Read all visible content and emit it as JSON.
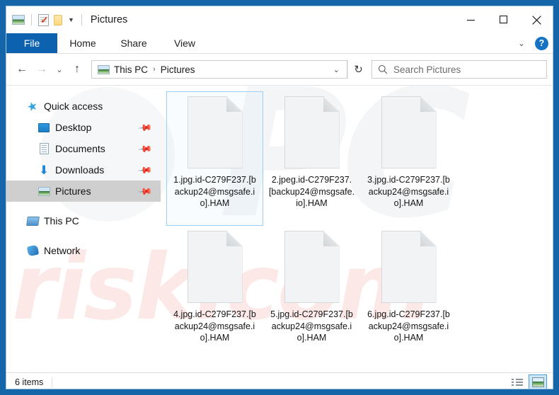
{
  "window": {
    "title": "Pictures",
    "quick_access_toolbar": [
      {
        "name": "pictures-icon",
        "label": "Pictures"
      },
      {
        "name": "properties-icon",
        "label": "Properties"
      },
      {
        "name": "new-folder-icon",
        "label": "New folder"
      },
      {
        "name": "customize-caret-icon",
        "label": "▾"
      }
    ],
    "controls": {
      "minimize": "Minimize",
      "maximize": "Maximize",
      "close": "Close"
    }
  },
  "ribbon": {
    "tabs": [
      {
        "label": "File",
        "active": true
      },
      {
        "label": "Home",
        "active": false
      },
      {
        "label": "Share",
        "active": false
      },
      {
        "label": "View",
        "active": false
      }
    ],
    "expand_caret": "⌄",
    "help_label": "?"
  },
  "navigation": {
    "back": "←",
    "forward": "→",
    "recent": "⌄",
    "up": "↑",
    "refresh": "↻",
    "address_caret": "⌄",
    "breadcrumb": [
      "This PC",
      "Pictures"
    ],
    "breadcrumb_separator": "›"
  },
  "search": {
    "placeholder": "Search Pictures",
    "value": "",
    "icon": "search-icon"
  },
  "sidebar": {
    "items": [
      {
        "label": "Quick access",
        "icon": "star-icon",
        "level": 0,
        "pinned": false,
        "selected": false
      },
      {
        "label": "Desktop",
        "icon": "desktop-icon",
        "level": 1,
        "pinned": true,
        "selected": false
      },
      {
        "label": "Documents",
        "icon": "document-icon",
        "level": 1,
        "pinned": true,
        "selected": false
      },
      {
        "label": "Downloads",
        "icon": "download-arrow-icon",
        "level": 1,
        "pinned": true,
        "selected": false
      },
      {
        "label": "Pictures",
        "icon": "pictures-icon",
        "level": 1,
        "pinned": true,
        "selected": true
      },
      {
        "label": "This PC",
        "icon": "this-pc-icon",
        "level": 0,
        "pinned": false,
        "selected": false
      },
      {
        "label": "Network",
        "icon": "network-icon",
        "level": 0,
        "pinned": false,
        "selected": false
      }
    ],
    "pin_glyph": "📌"
  },
  "files": [
    {
      "name": "1.jpg.id-C279F237.[backup24@msgsafe.io].HAM",
      "icon": "blank-file-icon",
      "selected": true
    },
    {
      "name": "2.jpeg.id-C279F237.[backup24@msgsafe.io].HAM",
      "icon": "blank-file-icon",
      "selected": false
    },
    {
      "name": "3.jpg.id-C279F237.[backup24@msgsafe.io].HAM",
      "icon": "blank-file-icon",
      "selected": false
    },
    {
      "name": "4.jpg.id-C279F237.[backup24@msgsafe.io].HAM",
      "icon": "blank-file-icon",
      "selected": false
    },
    {
      "name": "5.jpg.id-C279F237.[backup24@msgsafe.io].HAM",
      "icon": "blank-file-icon",
      "selected": false
    },
    {
      "name": "6.jpg.id-C279F237.[backup24@msgsafe.io].HAM",
      "icon": "blank-file-icon",
      "selected": false
    }
  ],
  "statusbar": {
    "item_count": "6 items",
    "views": [
      {
        "name": "details-view-button",
        "label": "Details view",
        "active": false
      },
      {
        "name": "large-icons-view-button",
        "label": "Large icons view",
        "active": true
      }
    ]
  },
  "watermark": {
    "big_text": "PC",
    "brand_text": "risk.com"
  },
  "colors": {
    "accent_blue": "#0d62b0",
    "frame_blue": "#1565a9",
    "selection_blue": "#99d1f2",
    "nav_selected_grey": "#cfcfcf",
    "watermark_pink": "#ec786e"
  }
}
